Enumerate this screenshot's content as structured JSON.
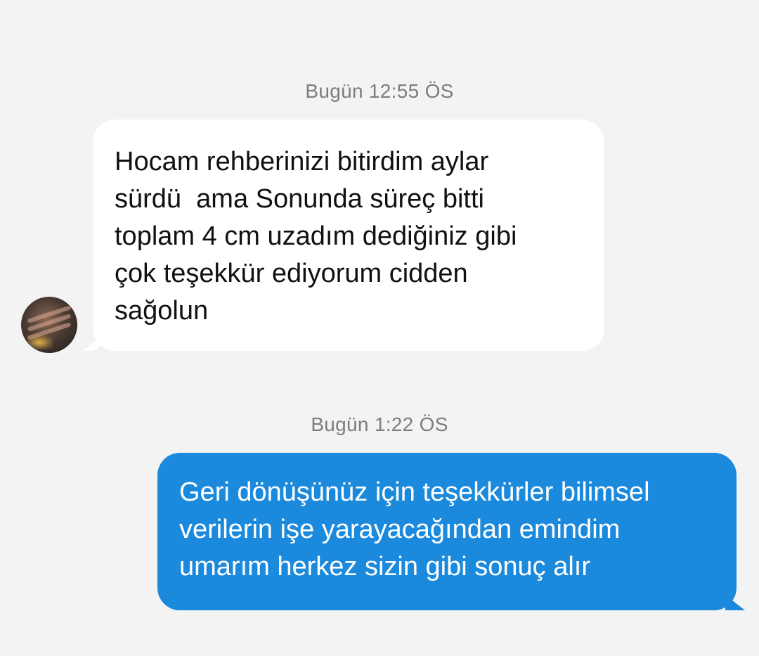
{
  "conversation": {
    "messages": [
      {
        "timestamp": "Bugün 12:55 ÖS",
        "direction": "incoming",
        "lines": [
          "Hocam rehberinizi bitirdim aylar",
          "sürdü  ama Sonunda süreç bitti",
          "toplam 4 cm uzadım dediğiniz gibi",
          "çok teşekkür ediyorum cidden",
          "sağolun"
        ]
      },
      {
        "timestamp": "Bugün 1:22 ÖS",
        "direction": "outgoing",
        "lines": [
          "Geri dönüşünüz için teşekkürler bilimsel",
          "verilerin işe yarayacağından emindim",
          "umarım herkez sizin gibi sonuç alır"
        ]
      }
    ]
  },
  "colors": {
    "background": "#f3f3f3",
    "incoming_bubble": "#ffffff",
    "outgoing_bubble": "#1b89dc",
    "timestamp_text": "#7d7d7d"
  }
}
